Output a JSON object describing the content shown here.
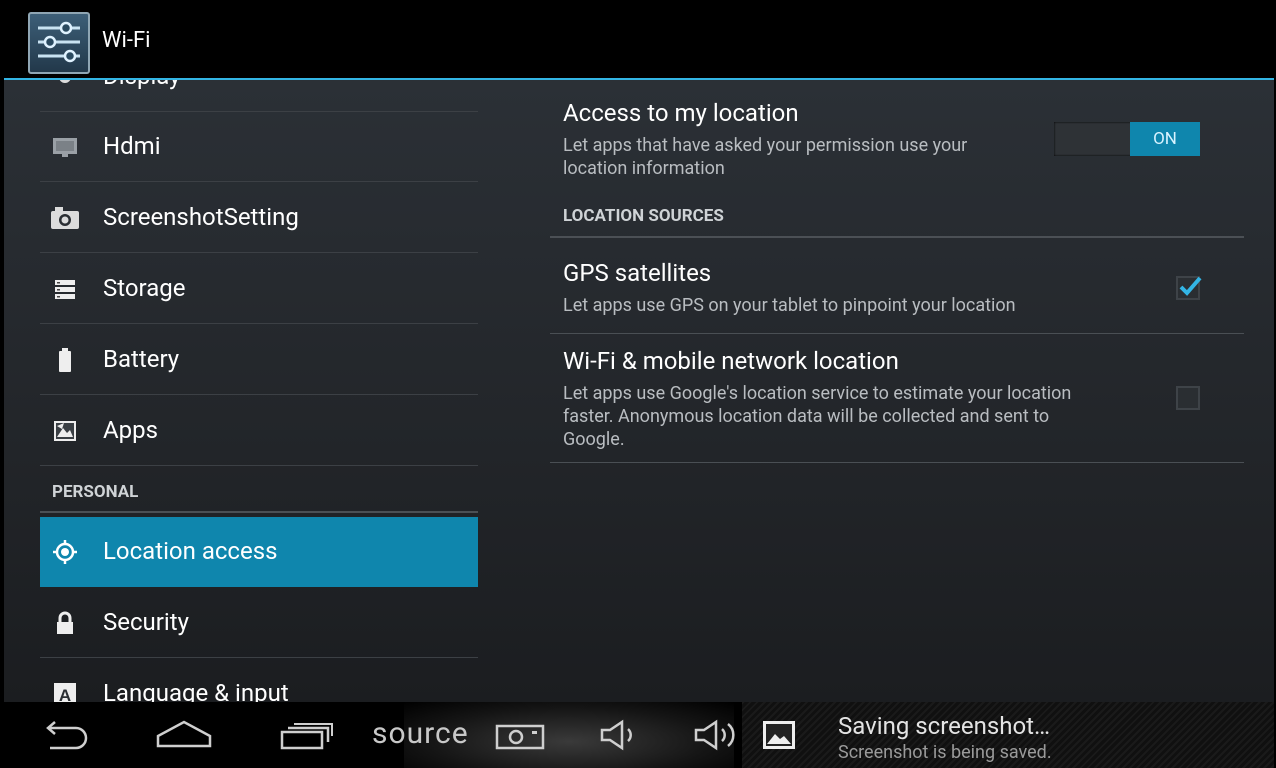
{
  "action_bar": {
    "title": "Wi-Fi"
  },
  "left_menu": {
    "partial_item": "Display",
    "items": [
      {
        "label": "Hdmi",
        "icon": "monitor-icon"
      },
      {
        "label": "ScreenshotSetting",
        "icon": "camera-icon"
      },
      {
        "label": "Storage",
        "icon": "storage-icon"
      },
      {
        "label": "Battery",
        "icon": "battery-icon"
      },
      {
        "label": "Apps",
        "icon": "apps-icon"
      }
    ],
    "section_personal": "PERSONAL",
    "personal_items": [
      {
        "label": "Location access",
        "icon": "location-icon",
        "selected": true
      },
      {
        "label": "Security",
        "icon": "lock-icon"
      },
      {
        "label": "Language & input",
        "icon": "keyboard-a-icon"
      }
    ]
  },
  "right_pane": {
    "access": {
      "title": "Access to my location",
      "summary": "Let apps that have asked your permission use your location information",
      "switch_label": "ON",
      "switch_on": true
    },
    "section_sources": "LOCATION SOURCES",
    "gps": {
      "title": "GPS satellites",
      "summary": "Let apps use GPS on your tablet to pinpoint your location",
      "checked": true
    },
    "wifi_location": {
      "title": "Wi-Fi & mobile network location",
      "summary": "Let apps use Google's location service to estimate your location faster. Anonymous location data will be collected and sent to Google.",
      "checked": false
    }
  },
  "nav_bar": {
    "source_label": "source",
    "notification_title": "Saving screenshot…",
    "notification_text": "Screenshot is being saved."
  },
  "colors": {
    "accent": "#33b5e5",
    "selected": "#0f86ad"
  }
}
